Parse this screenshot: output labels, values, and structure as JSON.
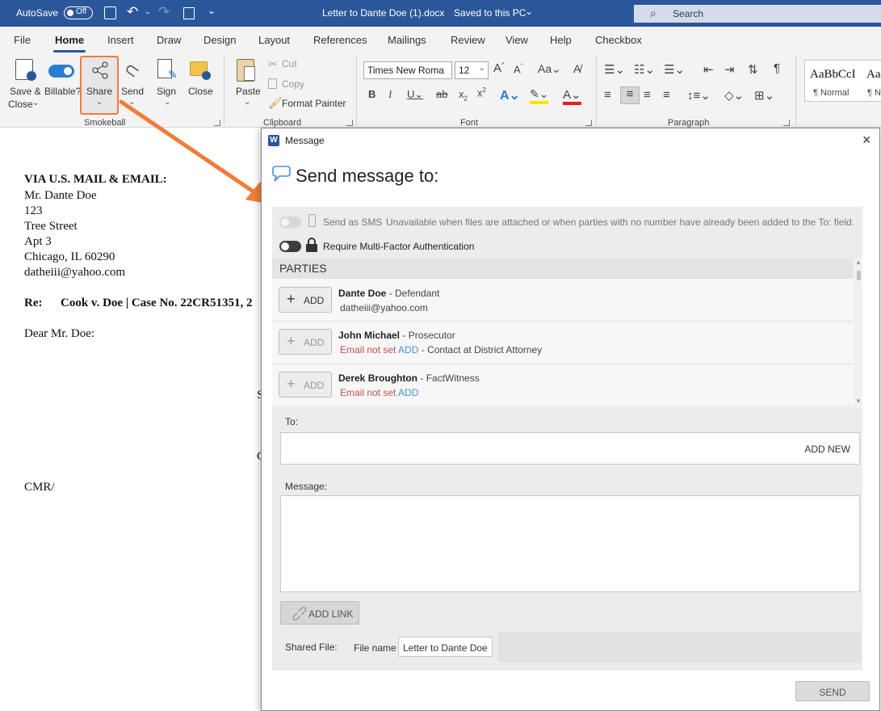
{
  "titlebar": {
    "autosave_label": "AutoSave",
    "autosave_state": "Off",
    "document_title": "Letter to Dante Doe (1).docx",
    "save_status": "Saved to this PC",
    "search_placeholder": "Search"
  },
  "menu": {
    "tabs": [
      "File",
      "Home",
      "Insert",
      "Draw",
      "Design",
      "Layout",
      "References",
      "Mailings",
      "Review",
      "View",
      "Help",
      "Checkbox"
    ],
    "active": "Home"
  },
  "ribbon": {
    "smokeball": {
      "save_close": "Save &",
      "save_close_2": "Close",
      "billable": "Billable?",
      "share": "Share",
      "send": "Send",
      "sign": "Sign",
      "close": "Close",
      "group_label": "Smokeball"
    },
    "clipboard": {
      "paste": "Paste",
      "cut": "Cut",
      "copy": "Copy",
      "format_painter": "Format Painter",
      "group_label": "Clipboard"
    },
    "font": {
      "font_name": "Times New Roma",
      "font_size": "12",
      "group_label": "Font"
    },
    "paragraph": {
      "group_label": "Paragraph"
    },
    "styles": {
      "normal_preview": "AaBbCcI",
      "normal_label": "¶ Normal",
      "next_preview": "Aa",
      "next_label": "¶ N"
    }
  },
  "document": {
    "lines": [
      "VIA U.S. MAIL & EMAIL:",
      "Mr. Dante Doe",
      "123",
      "Tree Street",
      "Apt 3",
      "Chicago, IL 60290",
      "datheiii@yahoo.com"
    ],
    "re_label": "Re:",
    "re_text": "Cook v. Doe | Case No. 22CR51351, 2",
    "salutation": "Dear Mr. Doe:",
    "frag_s": "S",
    "frag_c": "C",
    "initials": "CMR/"
  },
  "dialog": {
    "window_title": "Message",
    "heading": "Send message to:",
    "sms_label": "Send as SMS",
    "sms_note": "Unavailable when files are attached or when parties with no number have already been added to the To: field.",
    "mfa_label": "Require Multi-Factor Authentication",
    "parties_header": "PARTIES",
    "add_label": "ADD",
    "parties": [
      {
        "name": "Dante Doe",
        "role": "- Defendant",
        "email": "datheiii@yahoo.com"
      },
      {
        "name": "John Michael",
        "role": "- Prosecutor",
        "email_status": "Email not set",
        "add_link": "ADD",
        "note": "- Contact at District Attorney"
      },
      {
        "name": "Derek Broughton",
        "role": "- FactWitness",
        "email_status": "Email not set",
        "add_link": "ADD"
      }
    ],
    "to_label": "To:",
    "add_new": "ADD NEW",
    "message_label": "Message:",
    "add_link": "ADD LINK",
    "shared_file_label": "Shared File:",
    "file_name_label": "File name",
    "file_name_value": "Letter to Dante Doe",
    "send_button": "SEND"
  },
  "colors": {
    "titlebar": "#2b579a",
    "highlight_orange": "#f07d3a",
    "red_text": "#c0504d",
    "link_blue": "#4a90d9"
  }
}
